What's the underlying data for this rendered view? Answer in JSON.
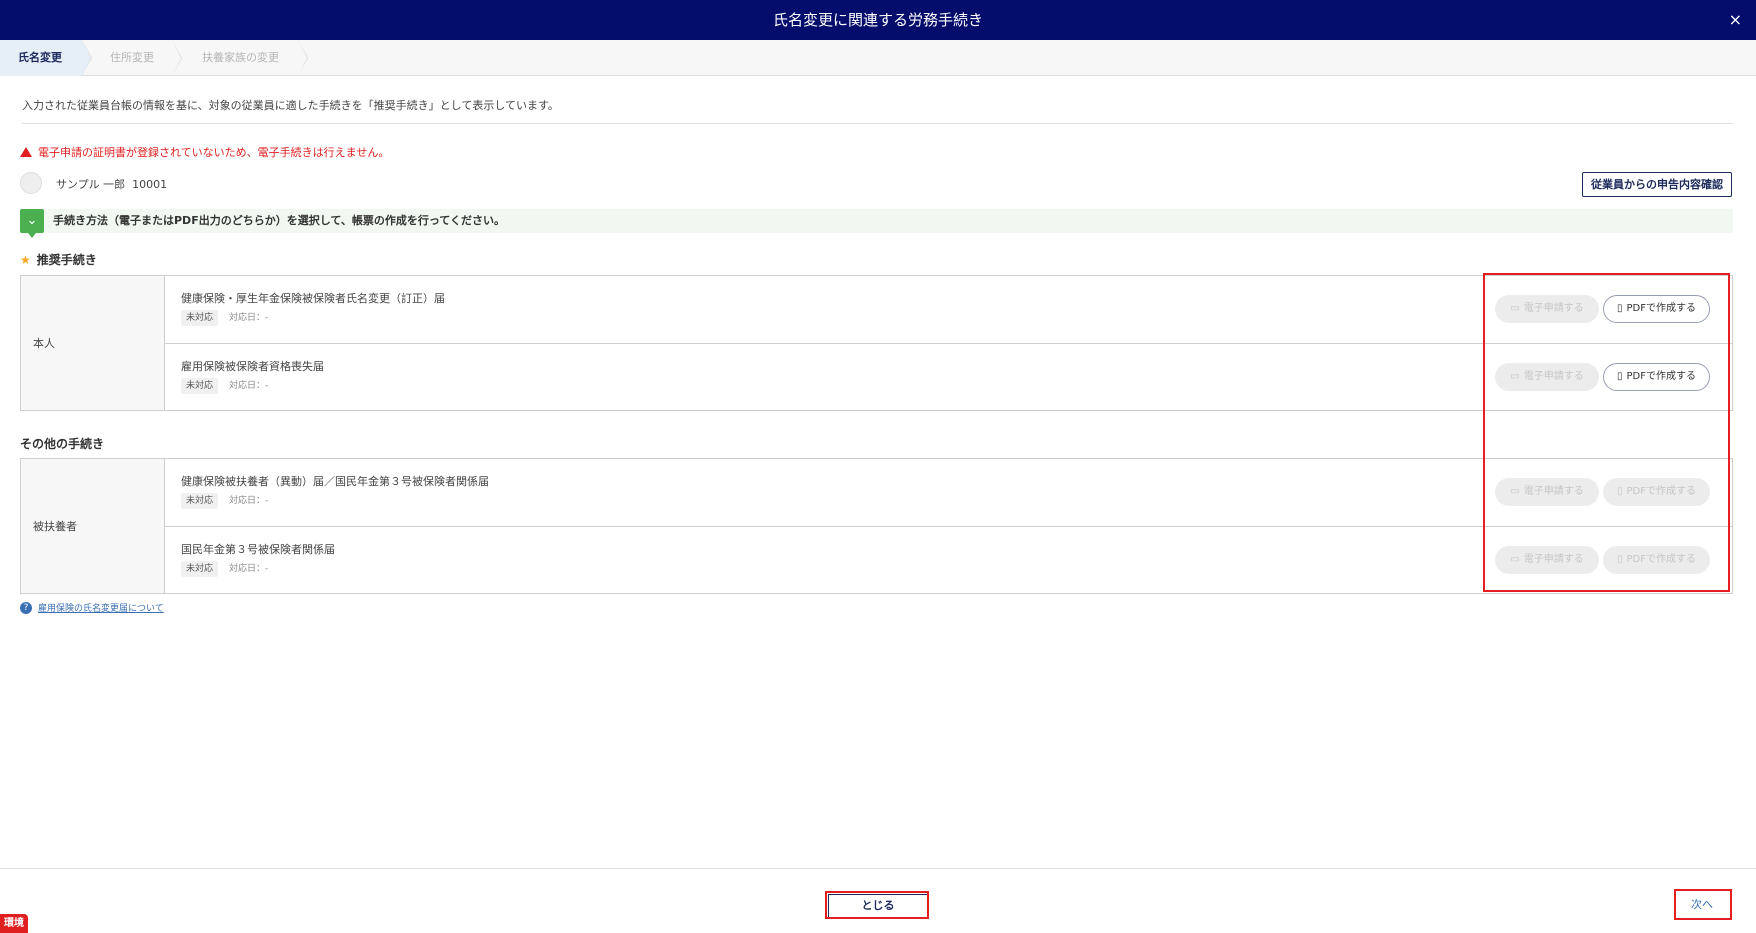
{
  "dialog": {
    "title": "氏名変更に関連する労務手続き",
    "close_icon": "close-icon",
    "close_glyph": "×"
  },
  "steps": [
    {
      "label": "氏名変更",
      "active": true
    },
    {
      "label": "住所変更",
      "active": false
    },
    {
      "label": "扶養家族の変更",
      "active": false
    }
  ],
  "intro_text": "入力された従業員台帳の情報を基に、対象の従業員に適した手続きを「推奨手続き」として表示しています。",
  "warning": {
    "text": "電子申請の証明書が登録されていないため、電子手続きは行えません。",
    "color": "#e02020"
  },
  "employee": {
    "name": "サンプル 一郎",
    "id": "10001"
  },
  "confirm_button": "従業員からの申告内容確認",
  "guide_text": "手続き方法（電子またはPDF出力のどちらか）を選択して、帳票の作成を行ってください。",
  "recommended": {
    "title": "推奨手続き",
    "group": "本人",
    "rows": [
      {
        "name": "健康保険・厚生年金保険被保険者氏名変更（訂正）届",
        "status": "未対応",
        "date_label": "対応日：-",
        "e_button": "電子申請する",
        "pdf_button": "PDFで作成する",
        "pdf_enabled": true
      },
      {
        "name": "雇用保険被保険者資格喪失届",
        "status": "未対応",
        "date_label": "対応日：-",
        "e_button": "電子申請する",
        "pdf_button": "PDFで作成する",
        "pdf_enabled": true
      }
    ]
  },
  "other": {
    "title": "その他の手続き",
    "group": "被扶養者",
    "rows": [
      {
        "name": "健康保険被扶養者（異動）届／国民年金第３号被保険者関係届",
        "status": "未対応",
        "date_label": "対応日：-",
        "e_button": "電子申請する",
        "pdf_button": "PDFで作成する",
        "pdf_enabled": false
      },
      {
        "name": "国民年金第３号被保険者関係届",
        "status": "未対応",
        "date_label": "対応日：-",
        "e_button": "電子申請する",
        "pdf_button": "PDFで作成する",
        "pdf_enabled": false
      }
    ]
  },
  "help_link": "雇用保険の氏名変更届について",
  "footer": {
    "close_button": "とじる",
    "next_button": "次へ"
  },
  "env_badge": "環境",
  "colors": {
    "header_bg": "#040c6c",
    "accent": "#1c2a5c",
    "guide_icon": "#4caf50",
    "highlight_box": "#e51f1f"
  }
}
